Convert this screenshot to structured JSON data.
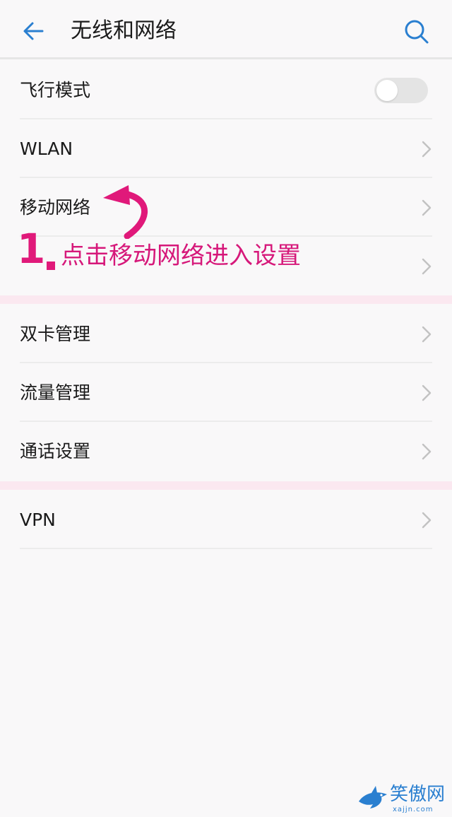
{
  "header": {
    "title": "无线和网络",
    "back_icon": "back-arrow-icon",
    "search_icon": "search-icon"
  },
  "groups": [
    {
      "items": [
        {
          "label": "飞行模式",
          "control": "toggle",
          "toggle_on": false
        },
        {
          "label": "WLAN",
          "control": "chevron"
        },
        {
          "label": "移动网络",
          "control": "chevron"
        },
        {
          "label": "",
          "control": "chevron"
        }
      ]
    },
    {
      "items": [
        {
          "label": "双卡管理",
          "control": "chevron"
        },
        {
          "label": "流量管理",
          "control": "chevron"
        },
        {
          "label": "通话设置",
          "control": "chevron"
        }
      ]
    },
    {
      "items": [
        {
          "label": "VPN",
          "control": "chevron"
        }
      ]
    }
  ],
  "annotation": {
    "step_number": "1",
    "instruction": "点击移动网络进入设置",
    "color": "#e0197a"
  },
  "watermark": {
    "text": "笑傲网",
    "subtext": "xajjn.com"
  },
  "colors": {
    "accent": "#2a7fd0",
    "group_gap": "#fbe8f0",
    "background": "#f9f8f9"
  }
}
